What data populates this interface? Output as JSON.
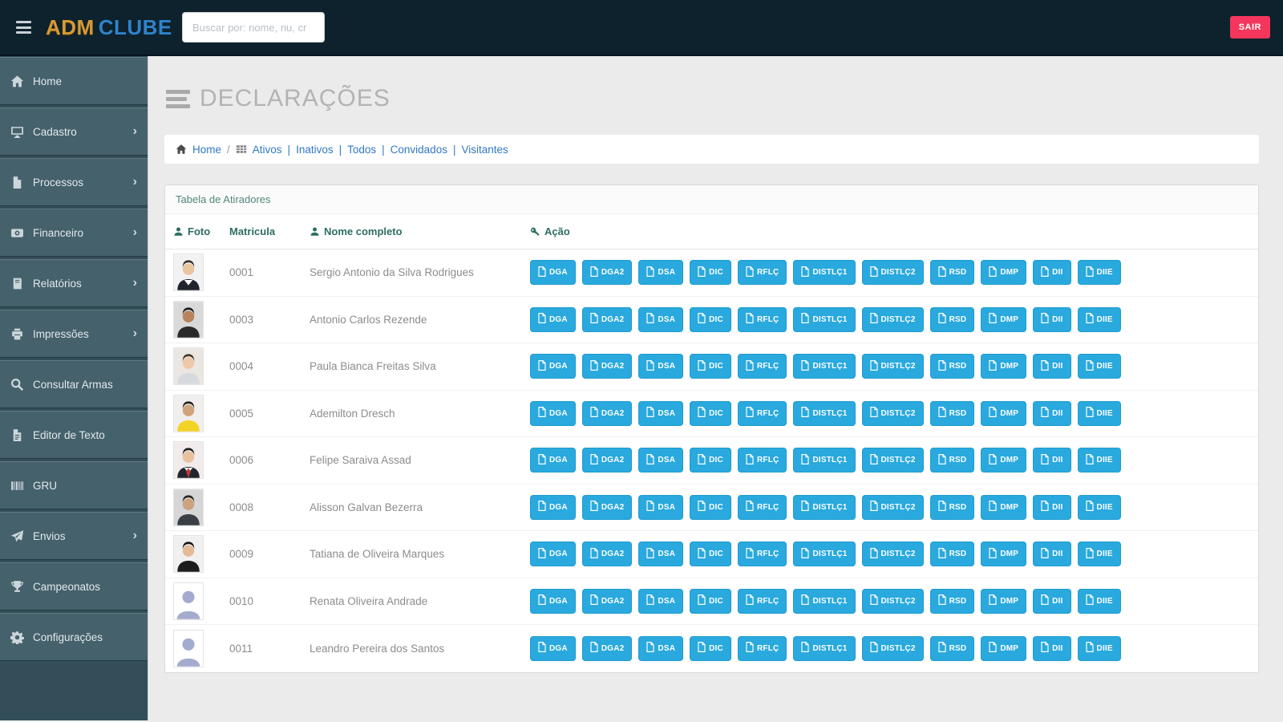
{
  "navbar": {
    "logo_adm": "ADM",
    "logo_clube": "CLUBE",
    "search_placeholder": "Buscar por: nome, nu, cr",
    "logout_label": "SAIR"
  },
  "sidebar": {
    "items": [
      {
        "label": "Home",
        "icon": "home-icon",
        "has_submenu": false
      },
      {
        "label": "Cadastro",
        "icon": "desktop-icon",
        "has_submenu": true
      },
      {
        "label": "Processos",
        "icon": "file-icon",
        "has_submenu": true
      },
      {
        "label": "Financeiro",
        "icon": "finance-icon",
        "has_submenu": true
      },
      {
        "label": "Relatórios",
        "icon": "book-icon",
        "has_submenu": true
      },
      {
        "label": "Impressões",
        "icon": "printer-icon",
        "has_submenu": true
      },
      {
        "label": "Consultar Armas",
        "icon": "search-icon",
        "has_submenu": false
      },
      {
        "label": "Editor de Texto",
        "icon": "file-text-icon",
        "has_submenu": false
      },
      {
        "label": "GRU",
        "icon": "barcode-icon",
        "has_submenu": false
      },
      {
        "label": "Envios",
        "icon": "send-icon",
        "has_submenu": true
      },
      {
        "label": "Campeonatos",
        "icon": "trophy-icon",
        "has_submenu": false
      },
      {
        "label": "Configurações",
        "icon": "gear-icon",
        "has_submenu": false
      }
    ]
  },
  "page": {
    "title": "DECLARAÇÕES"
  },
  "breadcrumb": {
    "home_label": "Home",
    "separator": "/",
    "filters": [
      "Ativos",
      "Inativos",
      "Todos",
      "Convidados",
      "Visitantes"
    ],
    "filter_separator": "|"
  },
  "panel": {
    "title": "Tabela de Atiradores",
    "columns": [
      "Foto",
      "Matricula",
      "Nome completo",
      "Ação"
    ]
  },
  "action_buttons": [
    "DGA",
    "DGA2",
    "DSA",
    "DIC",
    "RFLÇ",
    "DISTLÇ1",
    "DISTLÇ2",
    "RSD",
    "DMP",
    "DII",
    "DIIE"
  ],
  "rows": [
    {
      "matricula": "0001",
      "nome": "Sergio Antonio da Silva Rodrigues",
      "photo": {
        "type": "photo",
        "bg": "#f2f2f2",
        "hair": "#3a3027",
        "skin": "#e9c49e",
        "shirt": "#23252e",
        "collar": "#ffffff"
      }
    },
    {
      "matricula": "0003",
      "nome": "Antonio Carlos Rezende",
      "photo": {
        "type": "photo",
        "bg": "#d9d9d9",
        "hair": "#1f1b18",
        "skin": "#b8835a",
        "shirt": "#2a2a2a"
      }
    },
    {
      "matricula": "0004",
      "nome": "Paula Bianca Freitas Silva",
      "photo": {
        "type": "photo",
        "bg": "#eae6e2",
        "hair": "#4a3424",
        "skin": "#eccaa8",
        "shirt": "#d6dadd"
      }
    },
    {
      "matricula": "0005",
      "nome": "Ademilton Dresch",
      "photo": {
        "type": "photo",
        "bg": "#f0efed",
        "hair": "#23201c",
        "skin": "#cda47c",
        "shirt": "#f4d327"
      }
    },
    {
      "matricula": "0006",
      "nome": "Felipe Saraiva Assad",
      "photo": {
        "type": "photo",
        "bg": "#f2ebeb",
        "hair": "#211d1a",
        "skin": "#e7c29e",
        "shirt": "#23252e",
        "collar": "#ffffff",
        "tie": "#c23b2e"
      }
    },
    {
      "matricula": "0008",
      "nome": "Alisson Galvan Bezerra",
      "photo": {
        "type": "photo",
        "bg": "#d6d6d6",
        "hair": "#2b241f",
        "skin": "#cba37e",
        "shirt": "#3a3f45"
      }
    },
    {
      "matricula": "0009",
      "nome": "Tatiana de Oliveira Marques",
      "photo": {
        "type": "photo",
        "bg": "#f0f0f0",
        "hair": "#171210",
        "skin": "#e4ba97",
        "shirt": "#1d1d1d"
      }
    },
    {
      "matricula": "0010",
      "nome": "Renata Oliveira Andrade",
      "photo": {
        "type": "placeholder",
        "bg": "#ffffff",
        "silhouette": "#a3abce"
      }
    },
    {
      "matricula": "0011",
      "nome": "Leandro Pereira dos Santos",
      "photo": {
        "type": "placeholder",
        "bg": "#ffffff",
        "silhouette": "#a3abce"
      }
    }
  ],
  "colors": {
    "navbar_bg": "#0d222d",
    "sidebar_bg": "#334e58",
    "sidebar_item_bg": "#45616c",
    "action_button_blue": "#29a9de",
    "logout_red": "#f5365c",
    "link_blue": "#3079c5",
    "panel_title_teal": "#53857b",
    "table_header_teal": "#2e6d61",
    "logo_orange": "#d89a33",
    "logo_blue": "#2f83c9"
  }
}
